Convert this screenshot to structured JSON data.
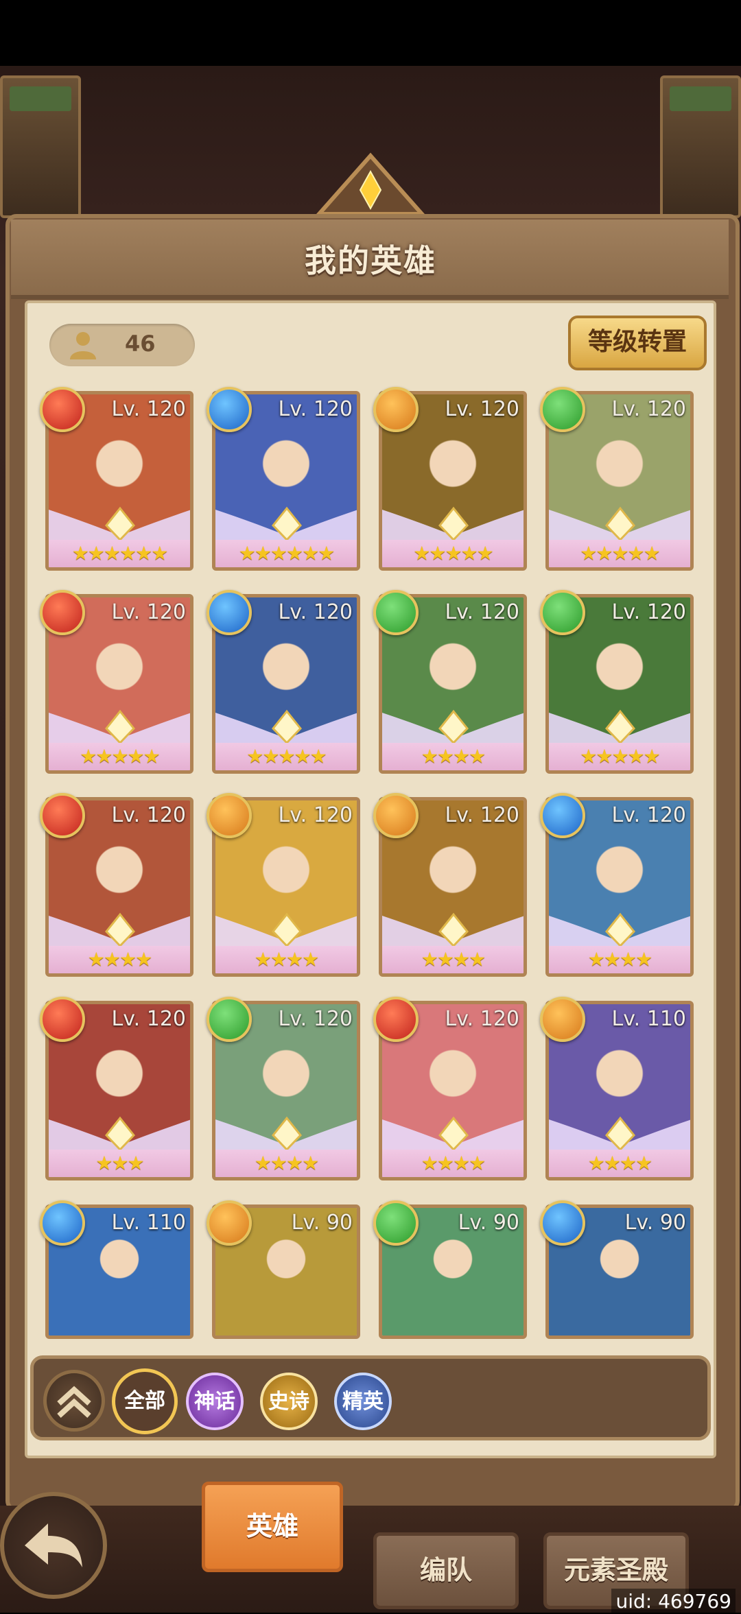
{
  "header": {
    "title": "我的英雄"
  },
  "hero_count": "46",
  "level_transfer_label": "等级转置",
  "colors": {
    "fire": "#c0221c",
    "water": "#1c63c6",
    "earth": "#d6781a",
    "wind": "#2c9a2a"
  },
  "heroes": [
    {
      "level": "Lv. 120",
      "element": "fire",
      "stars": "★★★★★★",
      "art": "#c5603b"
    },
    {
      "level": "Lv. 120",
      "element": "water",
      "stars": "★★★★★★",
      "art": "#4a63b5"
    },
    {
      "level": "Lv. 120",
      "element": "earth",
      "stars": "★★★★★",
      "art": "#8a6a2a"
    },
    {
      "level": "Lv. 120",
      "element": "wind",
      "stars": "★★★★★",
      "art": "#9aa36a"
    },
    {
      "level": "Lv. 120",
      "element": "fire",
      "stars": "★★★★★",
      "art": "#d16c5a"
    },
    {
      "level": "Lv. 120",
      "element": "water",
      "stars": "★★★★★",
      "art": "#3f5f9e"
    },
    {
      "level": "Lv. 120",
      "element": "wind",
      "stars": "★★★★",
      "art": "#5a8a4a"
    },
    {
      "level": "Lv. 120",
      "element": "wind",
      "stars": "★★★★★",
      "art": "#4a7a3a"
    },
    {
      "level": "Lv. 120",
      "element": "fire",
      "stars": "★★★★",
      "art": "#b2563a"
    },
    {
      "level": "Lv. 120",
      "element": "earth",
      "stars": "★★★★",
      "art": "#d9a940"
    },
    {
      "level": "Lv. 120",
      "element": "earth",
      "stars": "★★★★",
      "art": "#a8782e"
    },
    {
      "level": "Lv. 120",
      "element": "water",
      "stars": "★★★★",
      "art": "#4a80b0"
    },
    {
      "level": "Lv. 120",
      "element": "fire",
      "stars": "★★★",
      "art": "#a8463a"
    },
    {
      "level": "Lv. 120",
      "element": "wind",
      "stars": "★★★★",
      "art": "#7aa07a"
    },
    {
      "level": "Lv. 120",
      "element": "fire",
      "stars": "★★★★",
      "art": "#d9787a"
    },
    {
      "level": "Lv. 110",
      "element": "earth",
      "stars": "★★★★",
      "art": "#6a5aa8"
    },
    {
      "level": "Lv. 110",
      "element": "water",
      "stars": "",
      "art": "#3a70b8"
    },
    {
      "level": "Lv. 90",
      "element": "earth",
      "stars": "",
      "art": "#b89a3a"
    },
    {
      "level": "Lv. 90",
      "element": "wind",
      "stars": "",
      "art": "#5a9a6a"
    },
    {
      "level": "Lv. 90",
      "element": "water",
      "stars": "",
      "art": "#3a6aa0"
    }
  ],
  "filters": {
    "all": "全部",
    "mythic": "神话",
    "epic": "史诗",
    "elite": "精英"
  },
  "tabs": {
    "heroes": "英雄",
    "formation": "编队",
    "element_temple": "元素圣殿"
  },
  "uid": "uid: 469769"
}
